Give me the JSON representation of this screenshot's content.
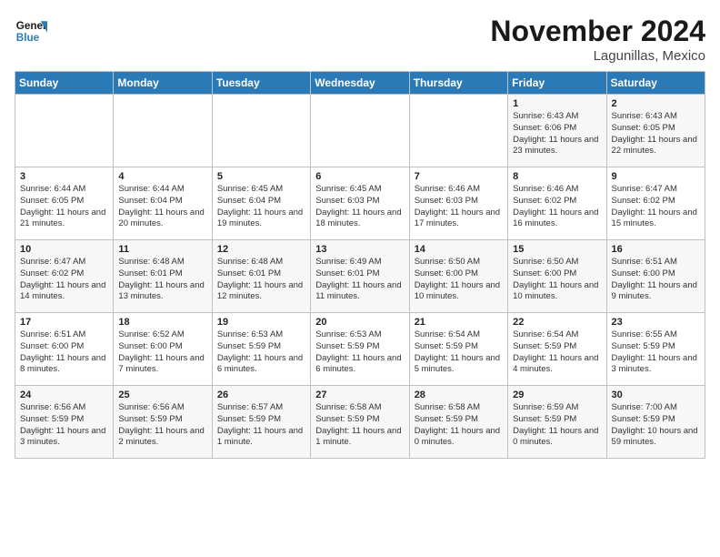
{
  "logo": {
    "line1": "General",
    "line2": "Blue"
  },
  "title": "November 2024",
  "location": "Lagunillas, Mexico",
  "days_of_week": [
    "Sunday",
    "Monday",
    "Tuesday",
    "Wednesday",
    "Thursday",
    "Friday",
    "Saturday"
  ],
  "weeks": [
    [
      {
        "day": "",
        "info": ""
      },
      {
        "day": "",
        "info": ""
      },
      {
        "day": "",
        "info": ""
      },
      {
        "day": "",
        "info": ""
      },
      {
        "day": "",
        "info": ""
      },
      {
        "day": "1",
        "info": "Sunrise: 6:43 AM\nSunset: 6:06 PM\nDaylight: 11 hours and 23 minutes."
      },
      {
        "day": "2",
        "info": "Sunrise: 6:43 AM\nSunset: 6:05 PM\nDaylight: 11 hours and 22 minutes."
      }
    ],
    [
      {
        "day": "3",
        "info": "Sunrise: 6:44 AM\nSunset: 6:05 PM\nDaylight: 11 hours and 21 minutes."
      },
      {
        "day": "4",
        "info": "Sunrise: 6:44 AM\nSunset: 6:04 PM\nDaylight: 11 hours and 20 minutes."
      },
      {
        "day": "5",
        "info": "Sunrise: 6:45 AM\nSunset: 6:04 PM\nDaylight: 11 hours and 19 minutes."
      },
      {
        "day": "6",
        "info": "Sunrise: 6:45 AM\nSunset: 6:03 PM\nDaylight: 11 hours and 18 minutes."
      },
      {
        "day": "7",
        "info": "Sunrise: 6:46 AM\nSunset: 6:03 PM\nDaylight: 11 hours and 17 minutes."
      },
      {
        "day": "8",
        "info": "Sunrise: 6:46 AM\nSunset: 6:02 PM\nDaylight: 11 hours and 16 minutes."
      },
      {
        "day": "9",
        "info": "Sunrise: 6:47 AM\nSunset: 6:02 PM\nDaylight: 11 hours and 15 minutes."
      }
    ],
    [
      {
        "day": "10",
        "info": "Sunrise: 6:47 AM\nSunset: 6:02 PM\nDaylight: 11 hours and 14 minutes."
      },
      {
        "day": "11",
        "info": "Sunrise: 6:48 AM\nSunset: 6:01 PM\nDaylight: 11 hours and 13 minutes."
      },
      {
        "day": "12",
        "info": "Sunrise: 6:48 AM\nSunset: 6:01 PM\nDaylight: 11 hours and 12 minutes."
      },
      {
        "day": "13",
        "info": "Sunrise: 6:49 AM\nSunset: 6:01 PM\nDaylight: 11 hours and 11 minutes."
      },
      {
        "day": "14",
        "info": "Sunrise: 6:50 AM\nSunset: 6:00 PM\nDaylight: 11 hours and 10 minutes."
      },
      {
        "day": "15",
        "info": "Sunrise: 6:50 AM\nSunset: 6:00 PM\nDaylight: 11 hours and 10 minutes."
      },
      {
        "day": "16",
        "info": "Sunrise: 6:51 AM\nSunset: 6:00 PM\nDaylight: 11 hours and 9 minutes."
      }
    ],
    [
      {
        "day": "17",
        "info": "Sunrise: 6:51 AM\nSunset: 6:00 PM\nDaylight: 11 hours and 8 minutes."
      },
      {
        "day": "18",
        "info": "Sunrise: 6:52 AM\nSunset: 6:00 PM\nDaylight: 11 hours and 7 minutes."
      },
      {
        "day": "19",
        "info": "Sunrise: 6:53 AM\nSunset: 5:59 PM\nDaylight: 11 hours and 6 minutes."
      },
      {
        "day": "20",
        "info": "Sunrise: 6:53 AM\nSunset: 5:59 PM\nDaylight: 11 hours and 6 minutes."
      },
      {
        "day": "21",
        "info": "Sunrise: 6:54 AM\nSunset: 5:59 PM\nDaylight: 11 hours and 5 minutes."
      },
      {
        "day": "22",
        "info": "Sunrise: 6:54 AM\nSunset: 5:59 PM\nDaylight: 11 hours and 4 minutes."
      },
      {
        "day": "23",
        "info": "Sunrise: 6:55 AM\nSunset: 5:59 PM\nDaylight: 11 hours and 3 minutes."
      }
    ],
    [
      {
        "day": "24",
        "info": "Sunrise: 6:56 AM\nSunset: 5:59 PM\nDaylight: 11 hours and 3 minutes."
      },
      {
        "day": "25",
        "info": "Sunrise: 6:56 AM\nSunset: 5:59 PM\nDaylight: 11 hours and 2 minutes."
      },
      {
        "day": "26",
        "info": "Sunrise: 6:57 AM\nSunset: 5:59 PM\nDaylight: 11 hours and 1 minute."
      },
      {
        "day": "27",
        "info": "Sunrise: 6:58 AM\nSunset: 5:59 PM\nDaylight: 11 hours and 1 minute."
      },
      {
        "day": "28",
        "info": "Sunrise: 6:58 AM\nSunset: 5:59 PM\nDaylight: 11 hours and 0 minutes."
      },
      {
        "day": "29",
        "info": "Sunrise: 6:59 AM\nSunset: 5:59 PM\nDaylight: 11 hours and 0 minutes."
      },
      {
        "day": "30",
        "info": "Sunrise: 7:00 AM\nSunset: 5:59 PM\nDaylight: 10 hours and 59 minutes."
      }
    ]
  ]
}
